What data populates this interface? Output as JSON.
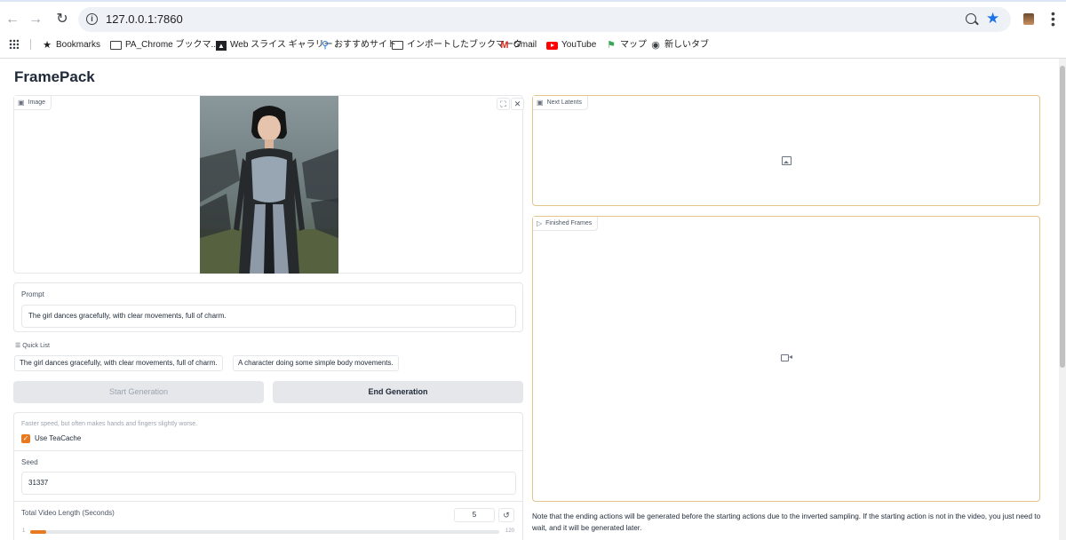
{
  "browser": {
    "url": "127.0.0.1:7860",
    "bookmarks": [
      {
        "label": "Bookmarks",
        "icon": "star-icon"
      },
      {
        "label": "PA_Chrome ブックマ...",
        "icon": "folder-icon"
      },
      {
        "label": "Web スライス ギャラリー",
        "icon": "web-slice-icon"
      },
      {
        "label": "おすすめサイト",
        "icon": "search-icon"
      },
      {
        "label": "インポートしたブックマーク",
        "icon": "folder-icon"
      },
      {
        "label": "Gmail",
        "icon": "gmail-icon"
      },
      {
        "label": "YouTube",
        "icon": "youtube-icon"
      },
      {
        "label": "マップ",
        "icon": "maps-icon"
      },
      {
        "label": "新しいタブ",
        "icon": "globe-icon"
      }
    ]
  },
  "page": {
    "title": "FramePack"
  },
  "image_panel": {
    "label": "Image"
  },
  "prompt": {
    "label": "Prompt",
    "value": "The girl dances gracefully, with clear movements, full of charm."
  },
  "quick_list": {
    "label": "Quick List",
    "items": [
      "The girl dances gracefully, with clear movements, full of charm.",
      "A character doing some simple body movements."
    ]
  },
  "buttons": {
    "start": "Start Generation",
    "end": "End Generation"
  },
  "settings": {
    "teacache_hint": "Faster speed, but often makes hands and fingers slightly worse.",
    "teacache_label": "Use TeaCache",
    "teacache_checked": true,
    "seed_label": "Seed",
    "seed_value": "31337",
    "video_length_label": "Total Video Length (Seconds)",
    "video_length_value": "5",
    "video_length_min": "1",
    "video_length_max": "120",
    "accent_color": "#e8791e"
  },
  "outputs": {
    "latents_label": "Next Latents",
    "frames_label": "Finished Frames",
    "note": "Note that the ending actions will be generated before the starting actions due to the inverted sampling. If the starting action is not in the video, you just need to wait, and it will be generated later."
  }
}
